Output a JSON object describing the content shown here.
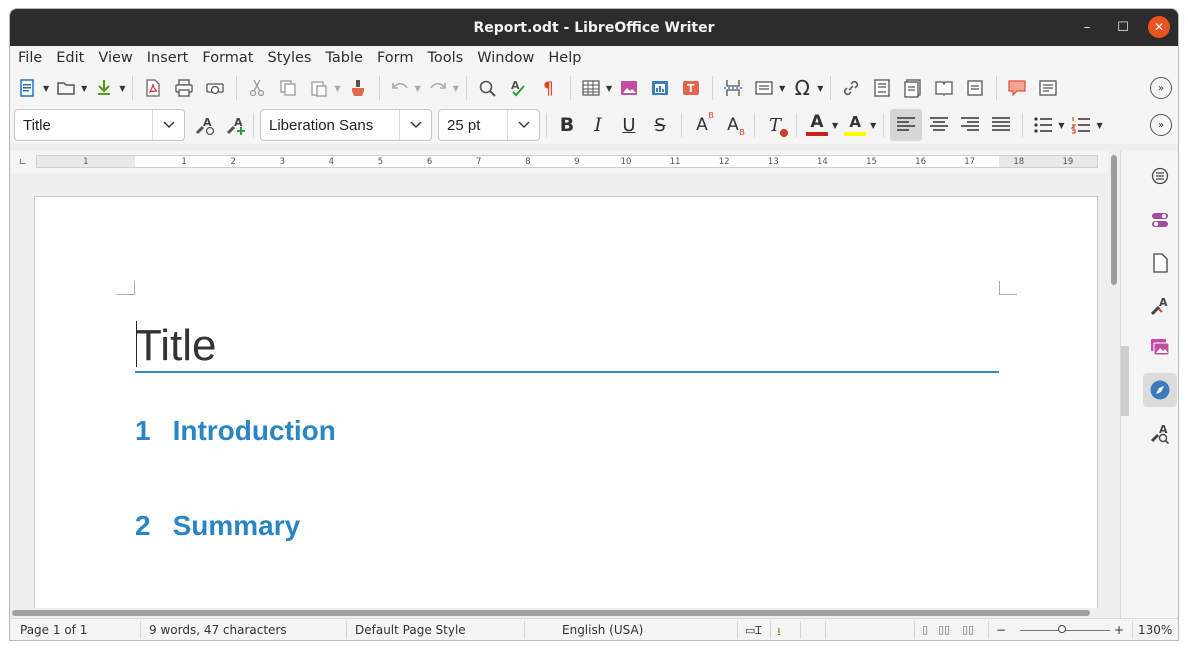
{
  "window": {
    "title": "Report.odt - LibreOffice Writer"
  },
  "window_controls": {
    "minimize": "–",
    "maximize": "☐",
    "close": "✕"
  },
  "menubar": {
    "items": [
      "File",
      "Edit",
      "View",
      "Insert",
      "Format",
      "Styles",
      "Table",
      "Form",
      "Tools",
      "Window",
      "Help"
    ]
  },
  "formatting": {
    "paragraph_style": "Title",
    "font_name": "Liberation Sans",
    "font_size": "25 pt",
    "bold": "B",
    "italic": "I",
    "underline": "U",
    "strikethrough": "S",
    "superscript": "A",
    "subscript": "A",
    "clear_formatting": "T",
    "font_color": "A",
    "highlight": "A",
    "special_character": "Ω"
  },
  "ruler": {
    "ticks": [
      "1",
      "1",
      "2",
      "3",
      "4",
      "5",
      "6",
      "7",
      "8",
      "9",
      "10",
      "11",
      "12",
      "13",
      "14",
      "15",
      "16",
      "17",
      "18",
      "19"
    ]
  },
  "document": {
    "title": "Title",
    "headings": [
      {
        "number": "1",
        "text": "Introduction"
      },
      {
        "number": "2",
        "text": "Summary"
      }
    ]
  },
  "statusbar": {
    "page": "Page 1 of 1",
    "words": "9 words, 47 characters",
    "page_style": "Default Page Style",
    "language": "English (USA)",
    "zoom": "130%",
    "zoom_minus": "−",
    "zoom_plus": "+"
  },
  "colors": {
    "accent": "#2a85c4",
    "title_rule": "#3588c2",
    "font_color_bar": "#c9211e",
    "highlight_bar": "#ffff00",
    "close": "#e95420"
  }
}
